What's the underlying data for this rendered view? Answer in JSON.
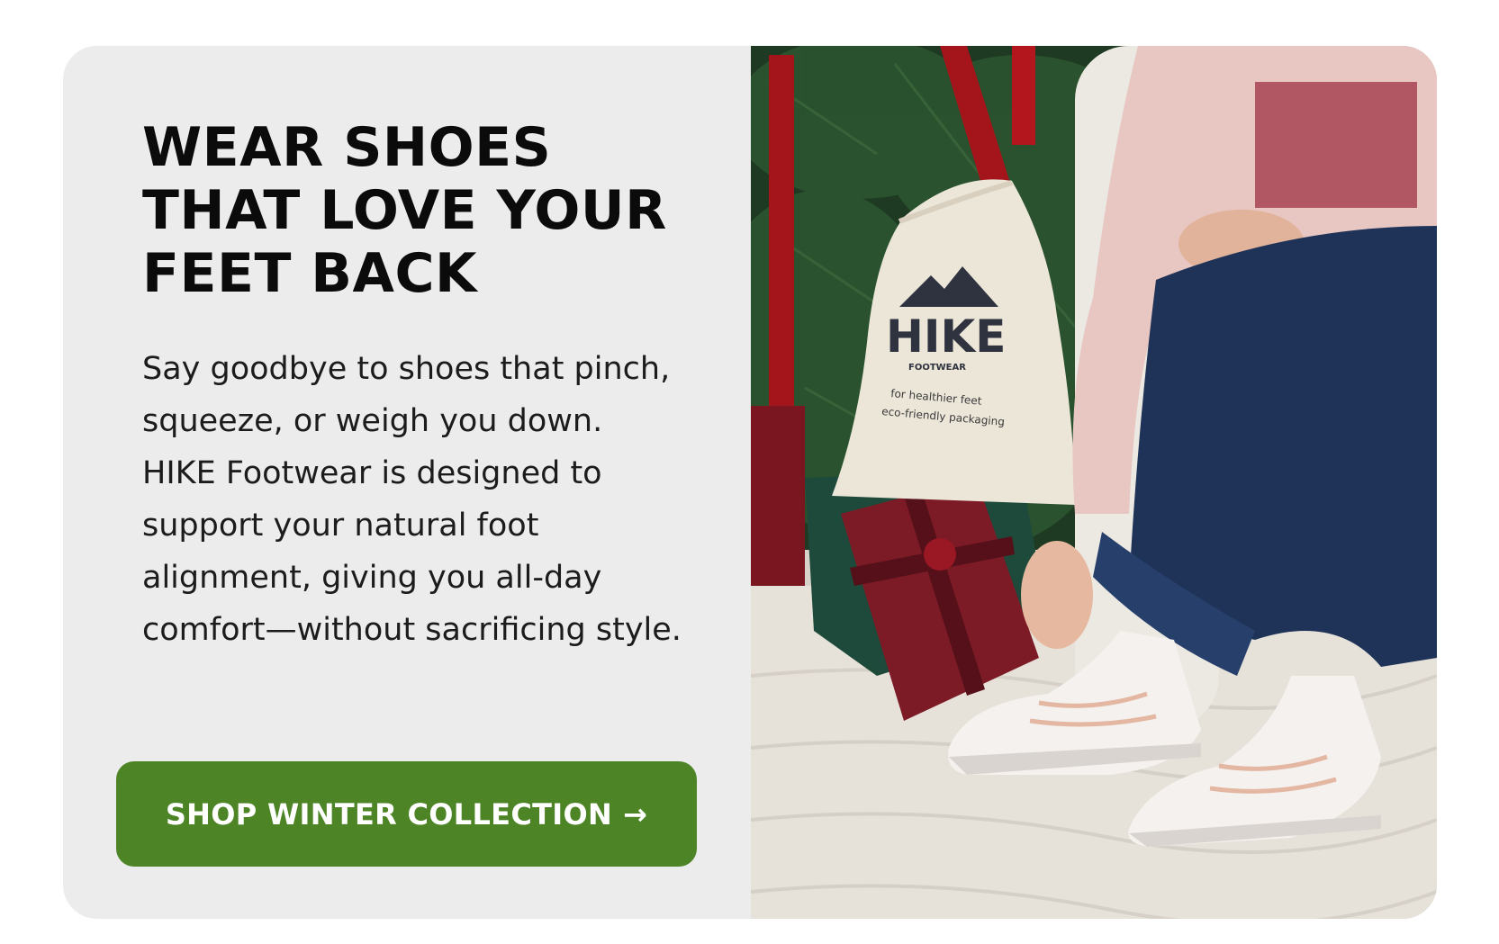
{
  "promo": {
    "headline_lines": [
      "WEAR SHOES",
      "THAT LOVE YOUR",
      "FEET BACK"
    ],
    "body": "Say goodbye to shoes that pinch, squeeze, or weigh you down. HIKE Footwear is designed to support your natural foot alignment, giving you all-day comfort—without sacrificing style.",
    "cta_label": "SHOP WINTER COLLECTION",
    "cta_arrow": "→"
  },
  "photo": {
    "bag_brand": "HIKE",
    "bag_sub": "FOOTWEAR",
    "bag_line1": "for healthier feet",
    "bag_line2": "eco-friendly packaging"
  },
  "colors": {
    "panel_bg": "#ececec",
    "cta_bg": "#4d8526",
    "headline": "#0b0b0b"
  }
}
